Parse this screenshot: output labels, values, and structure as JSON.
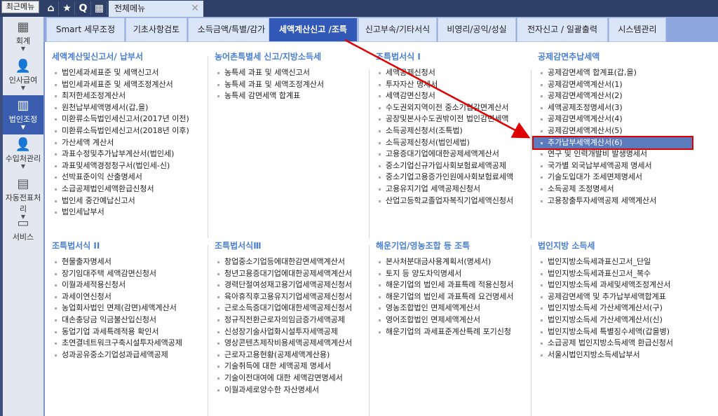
{
  "topbar": {
    "recent_label": "최근메뉴",
    "tab_label": "전체메뉴",
    "icons": [
      "home-icon",
      "star-icon",
      "search-icon",
      "calendar-icon"
    ],
    "q_label": "Q"
  },
  "sidebar": [
    {
      "label": "회계",
      "icon": "calculator-icon"
    },
    {
      "label": "인사급여",
      "icon": "person-icon"
    },
    {
      "label": "법인조정",
      "icon": "building-icon"
    },
    {
      "label": "수입처관리",
      "icon": "person-building-icon"
    },
    {
      "label": "자동전표처리",
      "icon": "database-icon"
    },
    {
      "label": "서비스",
      "icon": "monitor-icon"
    }
  ],
  "tabs": [
    "Smart 세무조정",
    "기초사항검토",
    "소득금액/특별/감가",
    "세액계산신고 /조특",
    "신고부속/기타서식",
    "비영리/공익/성실",
    "전자신고 / 일괄출력",
    "시스템관리"
  ],
  "active_tab": 3,
  "sections": [
    {
      "title": "세액계산및신고서/ 납부서",
      "items": [
        "법인세과세표준 및 세액신고서",
        "법인세과세표준 및 세액조정계산서",
        "최저한세조정계산서",
        "원천납부세액명세서(갑,을)",
        "미환류소득법인세신고서(2017년 이전)",
        "미환류소득법인세신고서(2018년 이후)",
        "가산세액 계산서",
        "과표수정및추가납부계산서(법인세)",
        "과표및세액경정청구서(법인세-신)",
        "선박표준이익 산출명세서",
        "소급공제법인세액환급신청서",
        "법인세 중간예납신고서",
        "법인세납부서"
      ]
    },
    {
      "title": "농어촌특별세 신고/지방소득세",
      "items": [
        "농특세 과표 및 세액신고서",
        "농특세 과표 및 세액조정계산서",
        "농특세 감면세액 합계표"
      ]
    },
    {
      "title": "조특법서식 I",
      "items": [
        "세액공제신청서",
        "투자자산 명세서",
        "세액감면신청서",
        "수도권외지역이전 중소기업감면계산서",
        "공장및본사수도권밖이전 법인감면세액",
        "소득공제신청서(조특법)",
        "소득공제신청서(법인세법)",
        "고용증대기업에대한공제세액계산서",
        "중소기업신규가입사회보험료세액공제",
        "중소기업고용증가인원에사회보험료세액",
        "고용유지기업 세액공제신청서",
        "산업고등학교졸업자복직기업세액신청서"
      ]
    },
    {
      "title": "공제감면추납세액",
      "items": [
        "공제감면세액 합계표(갑,을)",
        "공제감면세액계산서(1)",
        "공제감면세액계산서(2)",
        "세액공제조정명세서(3)",
        "공제감면세액계산서(4)",
        "공제감면세액계산서(5)",
        "추가납부세액계산서(6)",
        "연구 및 인력개발비 발생명세서",
        "국가별 외국납부세액공제 명세서",
        "기술도입대가 조세면제명세서",
        "소득공제 조정명세서",
        "고용창출투자세액공제 세액계산서"
      ],
      "selected": 6
    },
    {
      "title": "조특법서식 II",
      "items": [
        "현물출자명세서",
        "장기임대주택 세액감면신청서",
        "이월과세적용신청서",
        "과세이연신청서",
        "농업회사법인 면제(감면)세액계산서",
        "대손충당금 익금불산입신청서",
        "동업기업 과세특례적용 확인서",
        "초연결네트워크구축시설투자세액공제",
        "성과공유중소기업성과급세액공제"
      ]
    },
    {
      "title": "조특법서식Ⅲ",
      "items": [
        "창업중소기업등에대한감면세액계산서",
        "청년고용증대기업에대한공제세액계산서",
        "경력단절여성재고용기업세액공제신청서",
        "육아휴직후고용유지기업세액공제신청서",
        "근로소득증대기업에대한세액공제신청서",
        "정규직전환근로자의임금증가세액공제",
        "신성장기술사업화시설투자세액공제",
        "영상콘텐츠제작비용세액공제세액계산서",
        "근로자고용현황(공제세액계산용)",
        "기술취득에 대한 세액공제 명세서",
        "기술이전대여에 대한 세액감면명세서",
        "이월과세로양수한 자산명세서"
      ]
    },
    {
      "title": "해운기업/영농조합 등 조특",
      "items": [
        "본사처분대금사용계획서(명세서)",
        "토지 등 양도차익명세서",
        "해운기업의 법인세 과표특례 적용신청서",
        "해운기업의 법인세 과표특례 요건명세서",
        "영농조합법인 면제세액계산서",
        "영어조합법인 면제세액계산서",
        "해운기업의 과세표준계산특례 포기신청"
      ]
    },
    {
      "title": "법인지방 소득세",
      "items": [
        "법인지방소득세과표신고서_단일",
        "법인지방소득세과표신고서_복수",
        "법인지방소득세 과세및세액조정계산서",
        "공제감면세액 및 추가납부세액합계표",
        "법인지방소득세 가산세액계산서(구)",
        "법인지방소득세 가산세액계산서(신)",
        "법인지방소득세 특별징수세액(갑을병)",
        "소급공제 법인지방소득세액 환급신청서",
        "서울시법인지방소득세납부서"
      ]
    }
  ],
  "colors": {
    "active_tab": "#3258b8",
    "heading": "#4a7fd6",
    "selected_bg": "#5b7bbd",
    "highlight_border": "#e00000"
  }
}
